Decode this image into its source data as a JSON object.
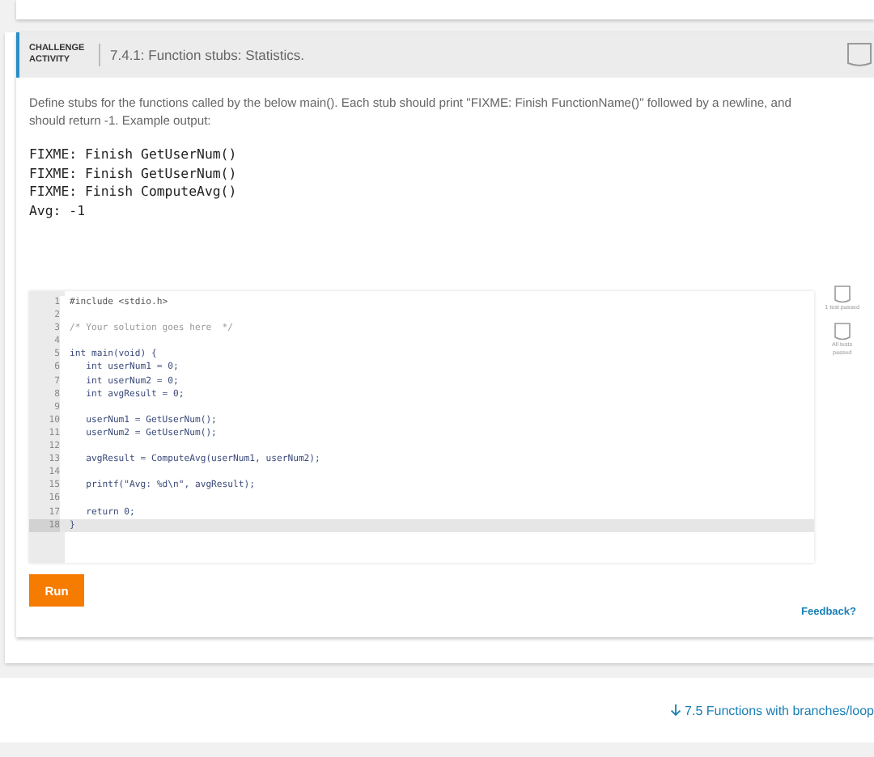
{
  "activity": {
    "badge": "CHALLENGE ACTIVITY",
    "title": "7.4.1: Function stubs: Statistics."
  },
  "instructions": "Define stubs for the functions called by the below main(). Each stub should print \"FIXME: Finish FunctionName()\" followed by a newline, and should return -1. Example output:",
  "example_output": [
    "FIXME: Finish GetUserNum()",
    "FIXME: Finish GetUserNum()",
    "FIXME: Finish ComputeAvg()",
    "Avg: -1"
  ],
  "editor": {
    "lines": [
      {
        "number": "1",
        "text": "#include <stdio.h>",
        "kind": "preprocessor",
        "selected": false
      },
      {
        "number": "2",
        "selected": false
      },
      {
        "number": "3",
        "text": "/* Your solution goes here  */",
        "kind": "comment",
        "selected": false
      },
      {
        "number": "4",
        "selected": false
      },
      {
        "number": "5",
        "text": "int main(void) {",
        "kind": "code",
        "selected": false
      },
      {
        "number": "6",
        "text": "   int userNum1 = 0;",
        "kind": "code",
        "selected": false
      },
      {
        "number": "7",
        "text": "   int userNum2 = 0;",
        "kind": "code",
        "selected": false
      },
      {
        "number": "8",
        "text": "   int avgResult = 0;",
        "kind": "code",
        "selected": false
      },
      {
        "number": "9",
        "selected": false
      },
      {
        "number": "10",
        "text": "   userNum1 = GetUserNum();",
        "kind": "code",
        "selected": false
      },
      {
        "number": "11",
        "text": "   userNum2 = GetUserNum();",
        "kind": "code",
        "selected": false
      },
      {
        "number": "12",
        "selected": false
      },
      {
        "number": "13",
        "text": "   avgResult = ComputeAvg(userNum1, userNum2);",
        "kind": "code",
        "selected": false
      },
      {
        "number": "14",
        "selected": false
      },
      {
        "number": "15",
        "text": "   printf(\"Avg: %d\\n\", avgResult);",
        "kind": "code",
        "selected": false
      },
      {
        "number": "16",
        "selected": false
      },
      {
        "number": "17",
        "text": "   return 0;",
        "kind": "code",
        "selected": false
      },
      {
        "number": "18",
        "text": "}",
        "kind": "code",
        "selected": true
      }
    ]
  },
  "tests": [
    {
      "label": "1 test passed",
      "passed": false
    },
    {
      "label": "All tests passed",
      "passed": false
    }
  ],
  "run_button": "Run",
  "feedback_link": "Feedback?",
  "next_section_link": "7.5 Functions with branches/loop"
}
